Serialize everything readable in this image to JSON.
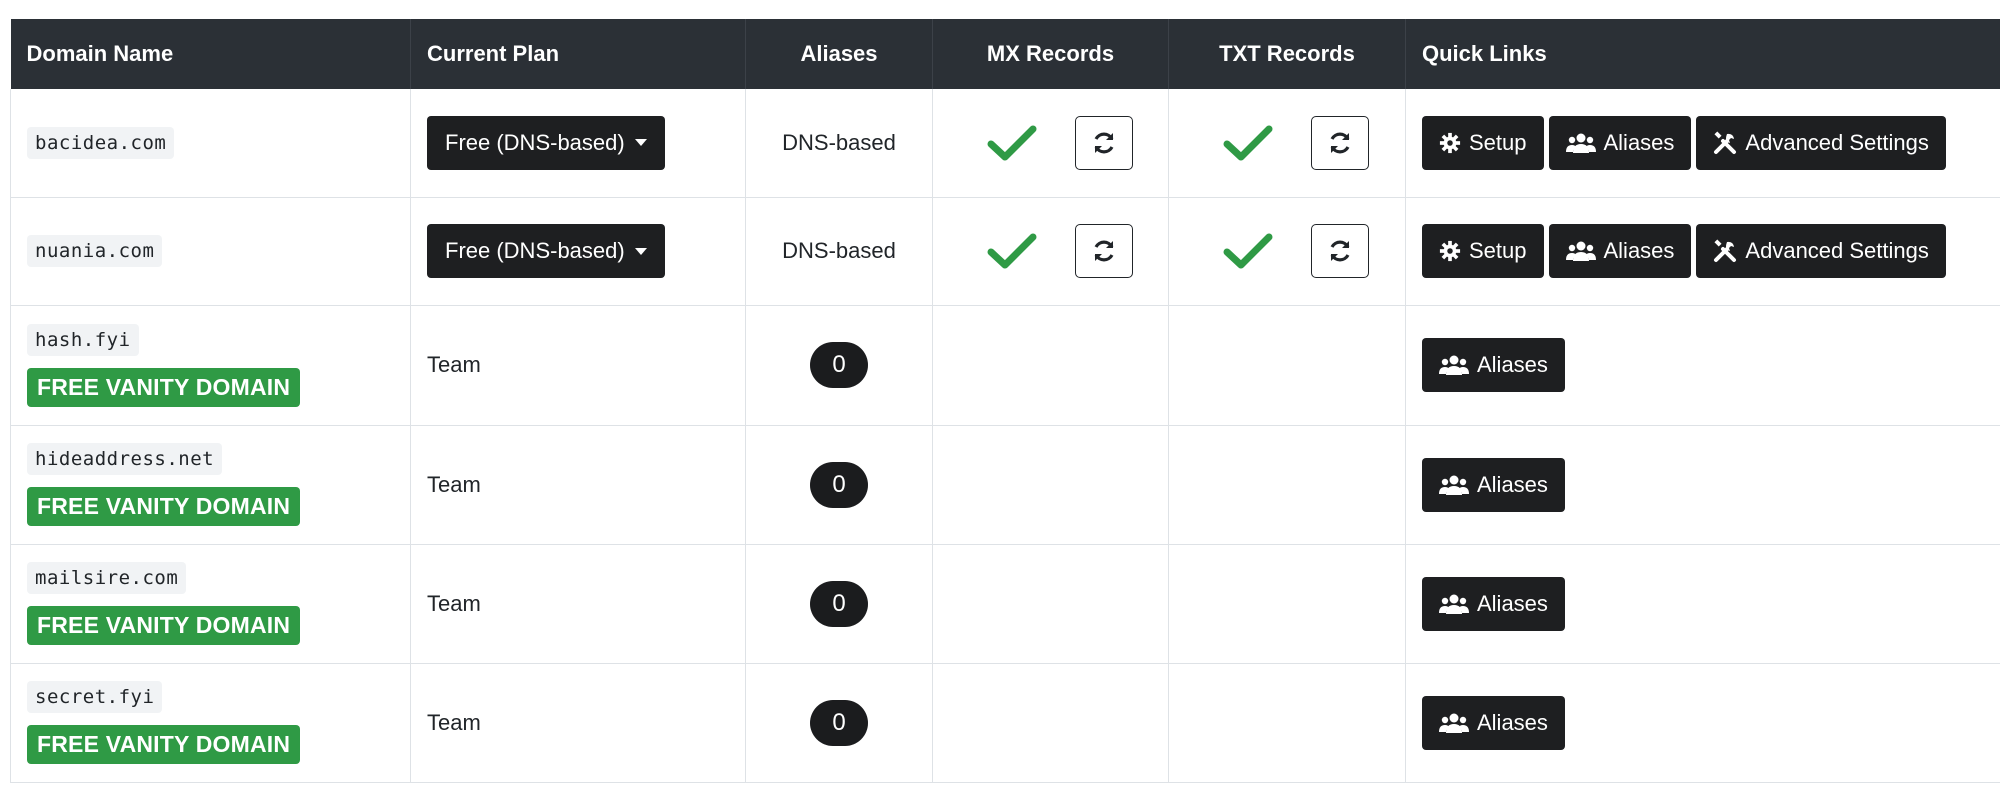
{
  "headers": {
    "domain": "Domain Name",
    "plan": "Current Plan",
    "aliases": "Aliases",
    "mx": "MX Records",
    "txt": "TXT Records",
    "links": "Quick Links"
  },
  "buttons": {
    "setup": "Setup",
    "aliases": "Aliases",
    "advanced": "Advanced Settings"
  },
  "rows": [
    {
      "domain": "bacidea.com",
      "plan": "Free (DNS-based)",
      "aliases": "DNS-based",
      "mx_icon": "check-icon",
      "txt_icon": "check-icon"
    },
    {
      "domain": "nuania.com",
      "plan": "Free (DNS-based)",
      "aliases": "DNS-based",
      "mx_icon": "check-icon",
      "txt_icon": "check-icon"
    },
    {
      "domain": "hash.fyi",
      "badge": "FREE VANITY DOMAIN",
      "plan": "Team",
      "alias_count": "0"
    },
    {
      "domain": "hideaddress.net",
      "badge": "FREE VANITY DOMAIN",
      "plan": "Team",
      "alias_count": "0"
    },
    {
      "domain": "mailsire.com",
      "badge": "FREE VANITY DOMAIN",
      "plan": "Team",
      "alias_count": "0"
    },
    {
      "domain": "secret.fyi",
      "badge": "FREE VANITY DOMAIN",
      "plan": "Team",
      "alias_count": "0"
    }
  ],
  "colors": {
    "header_bg": "#2b3036",
    "button_bg": "#1e1f21",
    "vanity_green": "#2f9a45",
    "check_green": "#2f9a45"
  }
}
